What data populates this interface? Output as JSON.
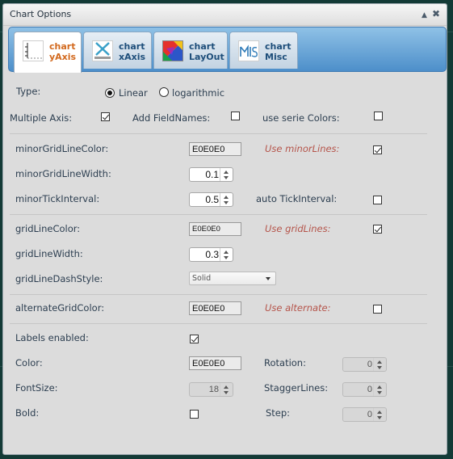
{
  "window": {
    "title": "Chart Options"
  },
  "tabs": [
    {
      "line1": "chart",
      "line2": "yAxis"
    },
    {
      "line1": "chart",
      "line2": "xAxis"
    },
    {
      "line1": "chart",
      "line2": "LayOut"
    },
    {
      "line1": "chart",
      "line2": "Misc"
    }
  ],
  "form": {
    "type_label": "Type:",
    "type_options": [
      "Linear",
      "logarithmic"
    ],
    "type_selected": "Linear",
    "multiple_axis_label": "Multiple Axis:",
    "multiple_axis_checked": true,
    "add_fieldnames_label": "Add FieldNames:",
    "add_fieldnames_checked": false,
    "use_serie_colors_label": "use serie Colors:",
    "use_serie_colors_checked": false,
    "minor_grid_line_color_label": "minorGridLineColor:",
    "minor_grid_line_color_value": "E0E0E0",
    "use_minor_lines_label": "Use minorLines:",
    "use_minor_lines_checked": true,
    "minor_grid_line_width_label": "minorGridLineWidth:",
    "minor_grid_line_width_value": "0.1",
    "minor_tick_interval_label": "minorTickInterval:",
    "minor_tick_interval_value": "0.5",
    "auto_tick_interval_label": "auto TickInterval:",
    "auto_tick_interval_checked": false,
    "grid_line_color_label": "gridLineColor:",
    "grid_line_color_value": "E0E0E0",
    "use_grid_lines_label": "Use gridLines:",
    "use_grid_lines_checked": true,
    "grid_line_width_label": "gridLineWidth:",
    "grid_line_width_value": "0.3",
    "grid_line_dash_style_label": "gridLineDashStyle:",
    "grid_line_dash_style_value": "Solid",
    "alternate_grid_color_label": "alternateGridColor:",
    "alternate_grid_color_value": "E0E0E0",
    "use_alternate_label": "Use alternate:",
    "use_alternate_checked": false,
    "labels_enabled_label": "Labels enabled:",
    "labels_enabled_checked": true,
    "color_label": "Color:",
    "color_value": "E0E0E0",
    "rotation_label": "Rotation:",
    "rotation_value": "0",
    "font_size_label": "FontSize:",
    "font_size_value": "18",
    "stagger_lines_label": "StaggerLines:",
    "stagger_lines_value": "0",
    "bold_label": "Bold:",
    "bold_checked": false,
    "step_label": "Step:",
    "step_value": "0"
  },
  "icons": {
    "minimize": "minimize-icon",
    "close": "close-icon",
    "yaxis": "chart-yaxis-icon",
    "xaxis": "chart-xaxis-icon",
    "layout": "chart-layout-icon",
    "misc": "chart-misc-icon"
  }
}
